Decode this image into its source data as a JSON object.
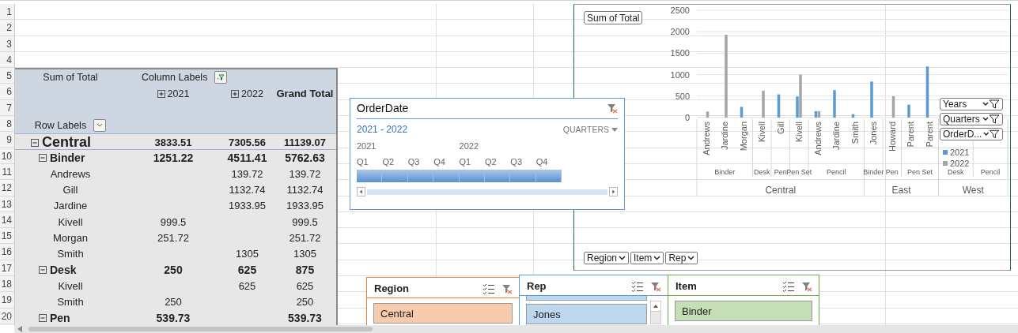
{
  "row_numbers": [
    "1",
    "2",
    "3",
    "4",
    "5",
    "6",
    "7",
    "8",
    "9",
    "10",
    "11",
    "12",
    "13",
    "14",
    "15",
    "16",
    "17",
    "18",
    "19",
    "20"
  ],
  "pivot": {
    "value_label": "Sum of Total",
    "column_labels": "Column Labels",
    "row_labels": "Row Labels",
    "columns": [
      {
        "label": "2021",
        "expanded": false
      },
      {
        "label": "2022",
        "expanded": false
      },
      {
        "label": "Grand Total"
      }
    ],
    "rows": [
      {
        "kind": "region",
        "label": "Central",
        "expanded": true,
        "value_2021": "3833.51",
        "value_2022": "7305.56",
        "grand_total": "11139.07"
      },
      {
        "kind": "item",
        "label": "Binder",
        "expanded": true,
        "value_2021": "1251.22",
        "value_2022": "4511.41",
        "grand_total": "5762.63"
      },
      {
        "kind": "rep",
        "label": "Andrews",
        "value_2022": "139.72",
        "grand_total": "139.72"
      },
      {
        "kind": "rep",
        "label": "Gill",
        "value_2022": "1132.74",
        "grand_total": "1132.74"
      },
      {
        "kind": "rep",
        "label": "Jardine",
        "value_2022": "1933.95",
        "grand_total": "1933.95"
      },
      {
        "kind": "rep",
        "label": "Kivell",
        "value_2021": "999.5",
        "grand_total": "999.5"
      },
      {
        "kind": "rep",
        "label": "Morgan",
        "value_2021": "251.72",
        "grand_total": "251.72"
      },
      {
        "kind": "rep",
        "label": "Smith",
        "value_2022": "1305",
        "grand_total": "1305"
      },
      {
        "kind": "item",
        "label": "Desk",
        "expanded": true,
        "value_2021": "250",
        "value_2022": "625",
        "grand_total": "875"
      },
      {
        "kind": "rep",
        "label": "Kivell",
        "value_2022": "625",
        "grand_total": "625"
      },
      {
        "kind": "rep",
        "label": "Smith",
        "value_2021": "250",
        "grand_total": "250"
      },
      {
        "kind": "item",
        "label": "Pen",
        "expanded": true,
        "value_2021": "539.73",
        "grand_total": "539.73"
      }
    ]
  },
  "timeline": {
    "title": "OrderDate",
    "range": "2021 - 2022",
    "level": "QUARTERS",
    "years": [
      {
        "label": "2021",
        "quarters": [
          {
            "label": "Q1",
            "selected": true
          },
          {
            "label": "Q2",
            "selected": true
          },
          {
            "label": "Q3",
            "selected": true
          },
          {
            "label": "Q4",
            "selected": true
          }
        ]
      },
      {
        "label": "2022",
        "quarters": [
          {
            "label": "Q1",
            "selected": true
          },
          {
            "label": "Q2",
            "selected": true
          },
          {
            "label": "Q3",
            "selected": true
          },
          {
            "label": "Q4",
            "selected": true
          }
        ]
      }
    ]
  },
  "chart": {
    "value_button": "Sum of Total",
    "field_buttons": [
      "Years",
      "Quarters",
      "OrderD..."
    ],
    "axis_buttons": [
      "Region",
      "Item",
      "Rep"
    ],
    "groups": [
      {
        "label": "Central",
        "items": [
          {
            "label": "Binder"
          },
          {
            "label": "Desk"
          },
          {
            "label": "Pen"
          },
          {
            "label": "Pen Set"
          },
          {
            "label": "Pencil"
          }
        ]
      },
      {
        "label": "East",
        "items": [
          {
            "label": "Binder"
          },
          {
            "label": "Pen"
          },
          {
            "label": "Pen Set"
          }
        ]
      },
      {
        "label": "West",
        "items": [
          {
            "label": "Desk"
          },
          {
            "label": "Pencil"
          }
        ]
      }
    ],
    "chart_data": {
      "type": "bar",
      "categories": [
        "Andrews",
        "Jardine",
        "Morgan",
        "Kivell",
        "Gill",
        "Kivell",
        "Andrews",
        "Jardine",
        "Smith",
        "Jones",
        "Howard",
        "Parent",
        "Parent"
      ],
      "series": [
        {
          "name": "2021",
          "color": "#5b9bd5",
          "values": [
            null,
            null,
            250,
            null,
            540,
            490,
            150,
            640,
            80,
            840,
            null,
            300,
            1190
          ]
        },
        {
          "name": "2022",
          "color": "#a5a5a5",
          "values": [
            140,
            1930,
            null,
            625,
            null,
            1000,
            150,
            null,
            null,
            null,
            500,
            null,
            null
          ]
        }
      ],
      "ylim": [
        0,
        2500
      ],
      "yticks": [
        0,
        500,
        1000,
        1500,
        2000,
        2500
      ],
      "grid": true,
      "legend": true
    }
  },
  "slicers": [
    {
      "title": "Region",
      "color": "#ed7d31",
      "scrollable": false,
      "items": [
        {
          "label": "Central",
          "selected": true
        }
      ]
    },
    {
      "title": "Rep",
      "color": "#5b9bd5",
      "scrollable": true,
      "items": [
        {
          "label": "Jones",
          "selected": true
        }
      ]
    },
    {
      "title": "Item",
      "color": "#70ad47",
      "scrollable": false,
      "items": [
        {
          "label": "Binder",
          "selected": true
        }
      ]
    }
  ]
}
